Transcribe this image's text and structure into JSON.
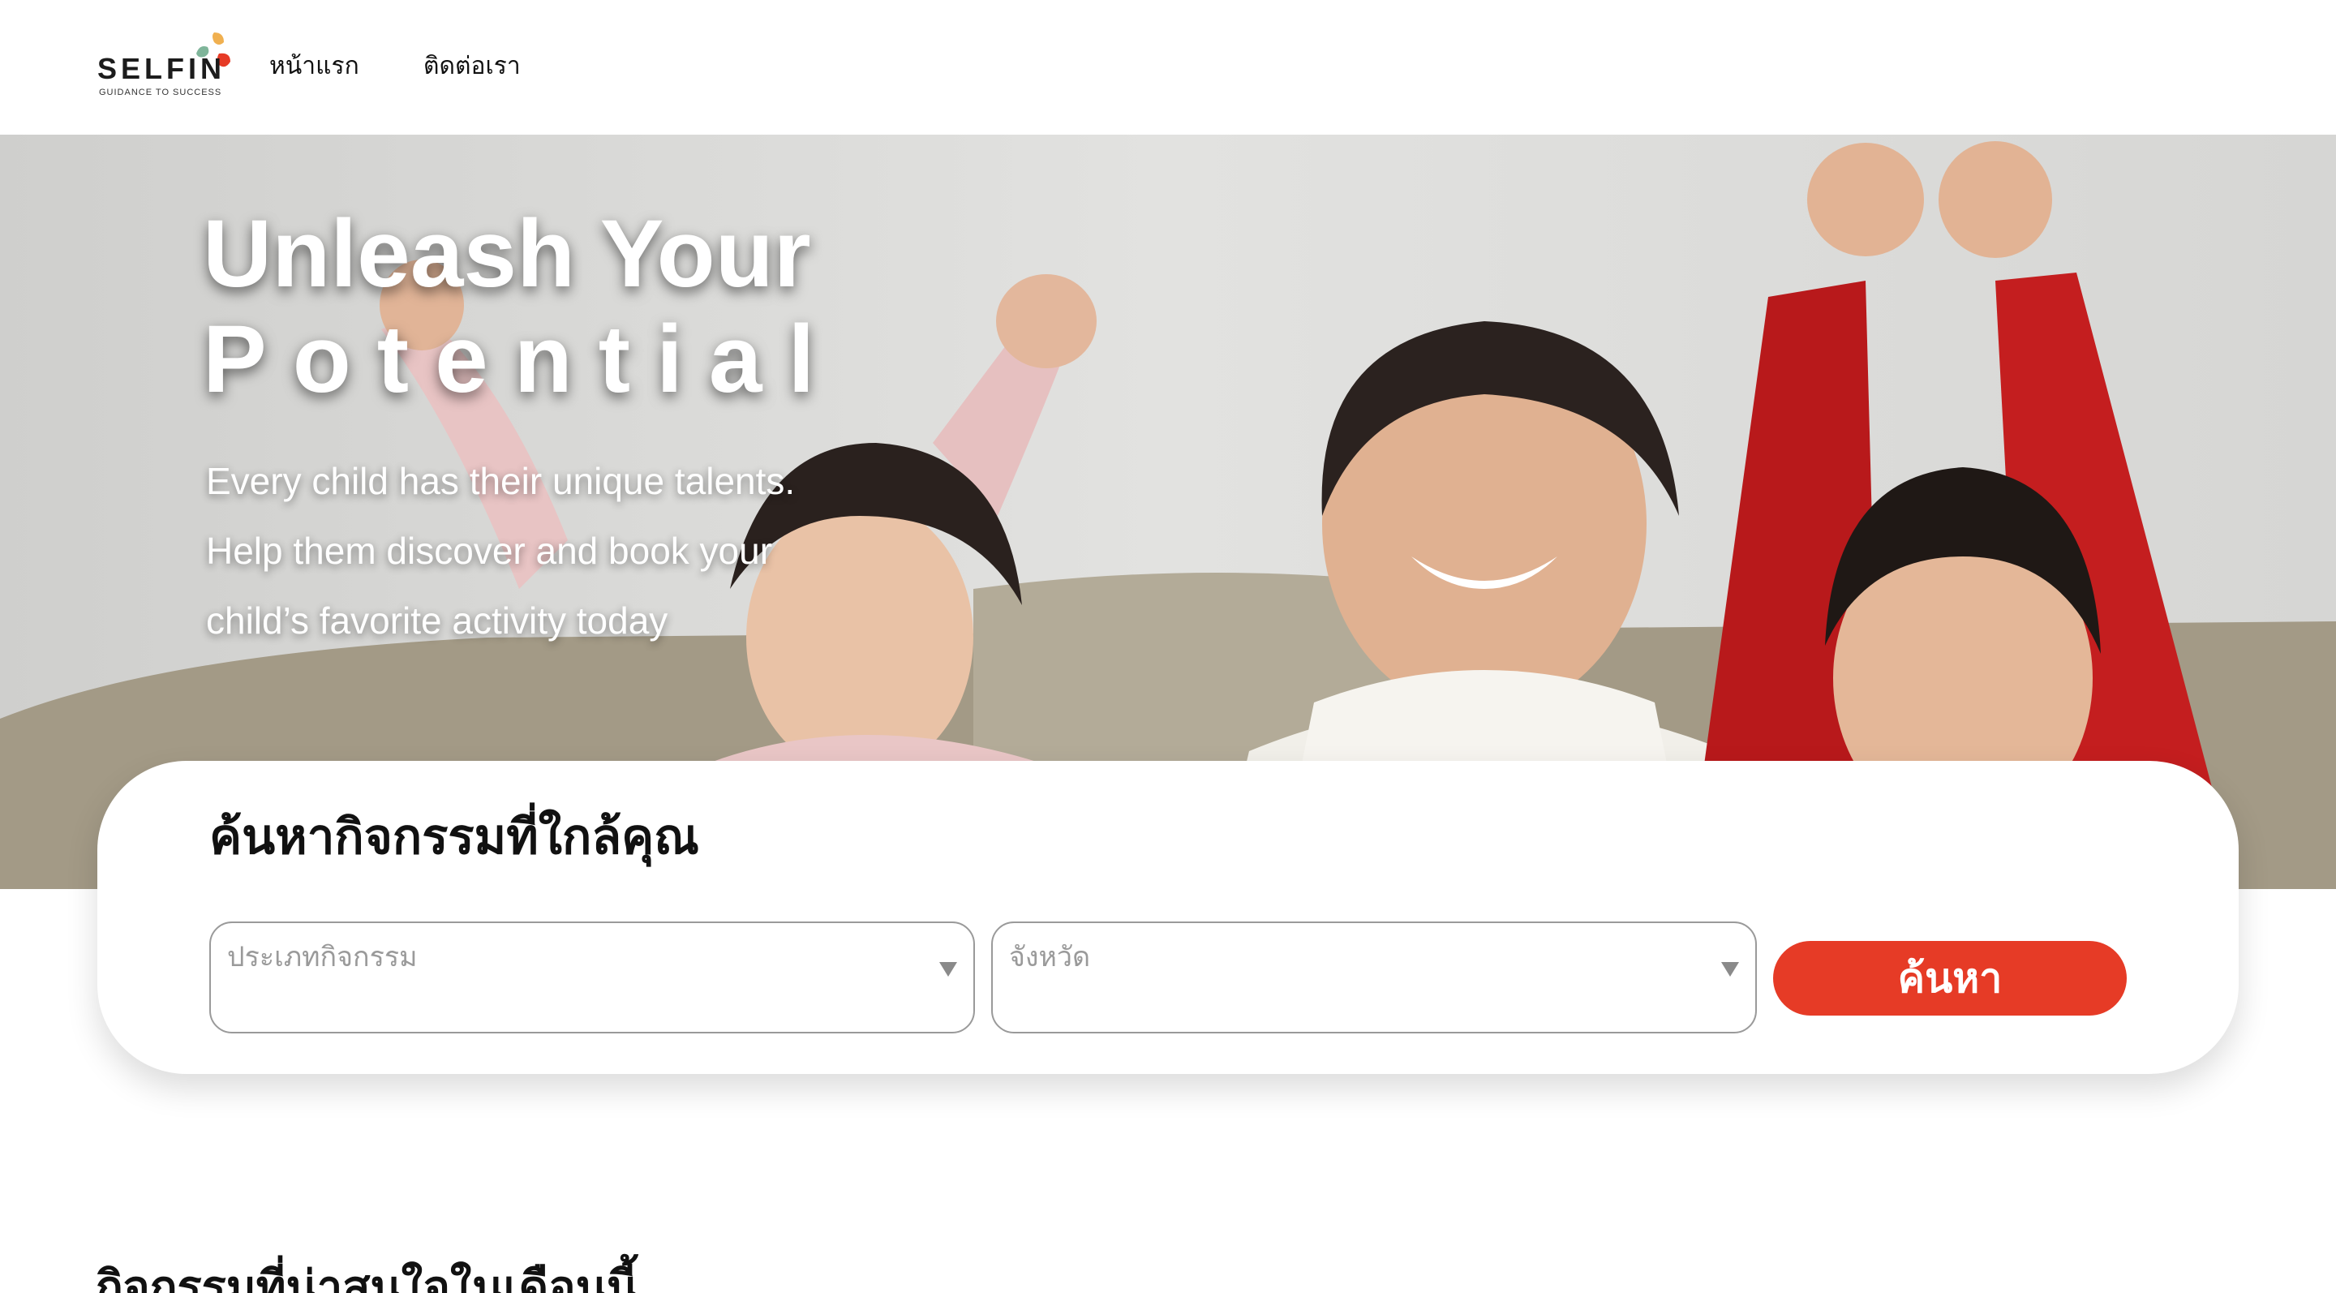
{
  "header": {
    "logo": {
      "word": "SELFIN",
      "tagline": "GUIDANCE TO SUCCESS",
      "colors": [
        "#7fb59a",
        "#f0b050",
        "#e63b26"
      ]
    },
    "nav": [
      {
        "label": "หน้าแรก"
      },
      {
        "label": "ติดต่อเรา"
      }
    ]
  },
  "hero": {
    "title_line1": "Unleash Your",
    "title_line2": "Potential",
    "subtitle_lines": [
      "Every child has their unique talents.",
      "Help them discover and book your",
      "child’s favorite activity today"
    ],
    "image": "family-cheering-photo"
  },
  "search": {
    "title": "ค้นหากิจกรรมที่ใกล้คุณ",
    "activity_type": {
      "placeholder": "ประเภทกิจกรรม",
      "icon": "chevron-down-icon"
    },
    "province": {
      "placeholder": "จังหวัด",
      "icon": "chevron-down-icon"
    },
    "button_label": "ค้นหา",
    "accent": "#e63b26"
  },
  "section": {
    "title": "กิจกรรมที่น่าสนใจในเดือนนี้"
  }
}
